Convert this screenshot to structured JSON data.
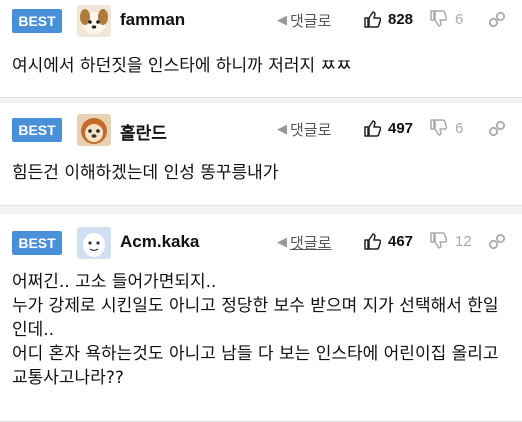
{
  "comments": [
    {
      "badge": "BEST",
      "username": "famman",
      "reply_label": "댓글로",
      "likes": "828",
      "dislikes": "6",
      "text": "여시에서 하던짓을 인스타에 하니까 저러지 ㅉㅉ"
    },
    {
      "badge": "BEST",
      "username": "홀란드",
      "reply_label": "댓글로",
      "likes": "497",
      "dislikes": "6",
      "text": "힘든건 이해하겠는데 인성 똥꾸릉내가"
    },
    {
      "badge": "BEST",
      "username": "Acm.kaka",
      "reply_label": "댓글로",
      "likes": "467",
      "dislikes": "12",
      "text": "어쩌긴.. 고소 들어가면되지..\n누가 강제로 시킨일도 아니고 정당한 보수 받으며 지가 선택해서 한일인데..\n어디 혼자 욕하는것도 아니고 남들 다 보는 인스타에 어린이집 올리고 교통사고나라??"
    }
  ],
  "icons": {
    "reply": "reply-arrow-icon",
    "like": "thumbs-up-icon",
    "dislike": "thumbs-down-icon",
    "link": "link-icon"
  },
  "colors": {
    "badge": "#4a90d9"
  }
}
